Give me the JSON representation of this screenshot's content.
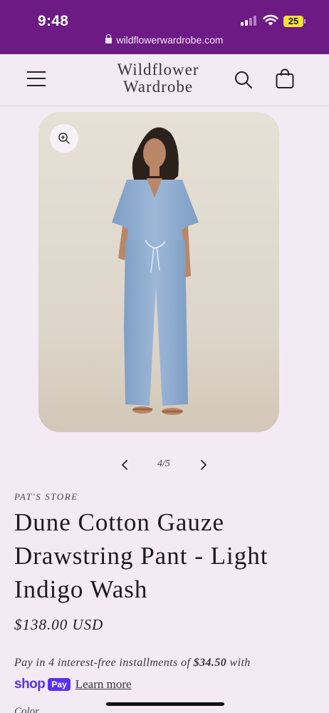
{
  "status_bar": {
    "time": "9:48",
    "url": "wildflowerwardrobe.com",
    "battery": "25",
    "signal_bars_active": 2
  },
  "header": {
    "brand_line1": "Wildflower",
    "brand_line2": "Wardrobe"
  },
  "slider": {
    "counter": "4/5"
  },
  "product": {
    "vendor": "PAT'S STORE",
    "title": "Dune Cotton Gauze Drawstring Pant - Light Indigo Wash",
    "price": "$138.00 USD"
  },
  "shop_pay": {
    "prefix": "Pay in 4 interest-free installments of ",
    "amount": "$34.50",
    "suffix": " with",
    "shop_label": "shop",
    "pay_label": "Pay",
    "learn_more": "Learn more"
  },
  "options": {
    "color_label": "Color"
  },
  "colors": {
    "status_bar": "#6e1a85",
    "background": "#f3eaf4",
    "shop_pay": "#5a31f4",
    "battery": "#f7e03a"
  }
}
